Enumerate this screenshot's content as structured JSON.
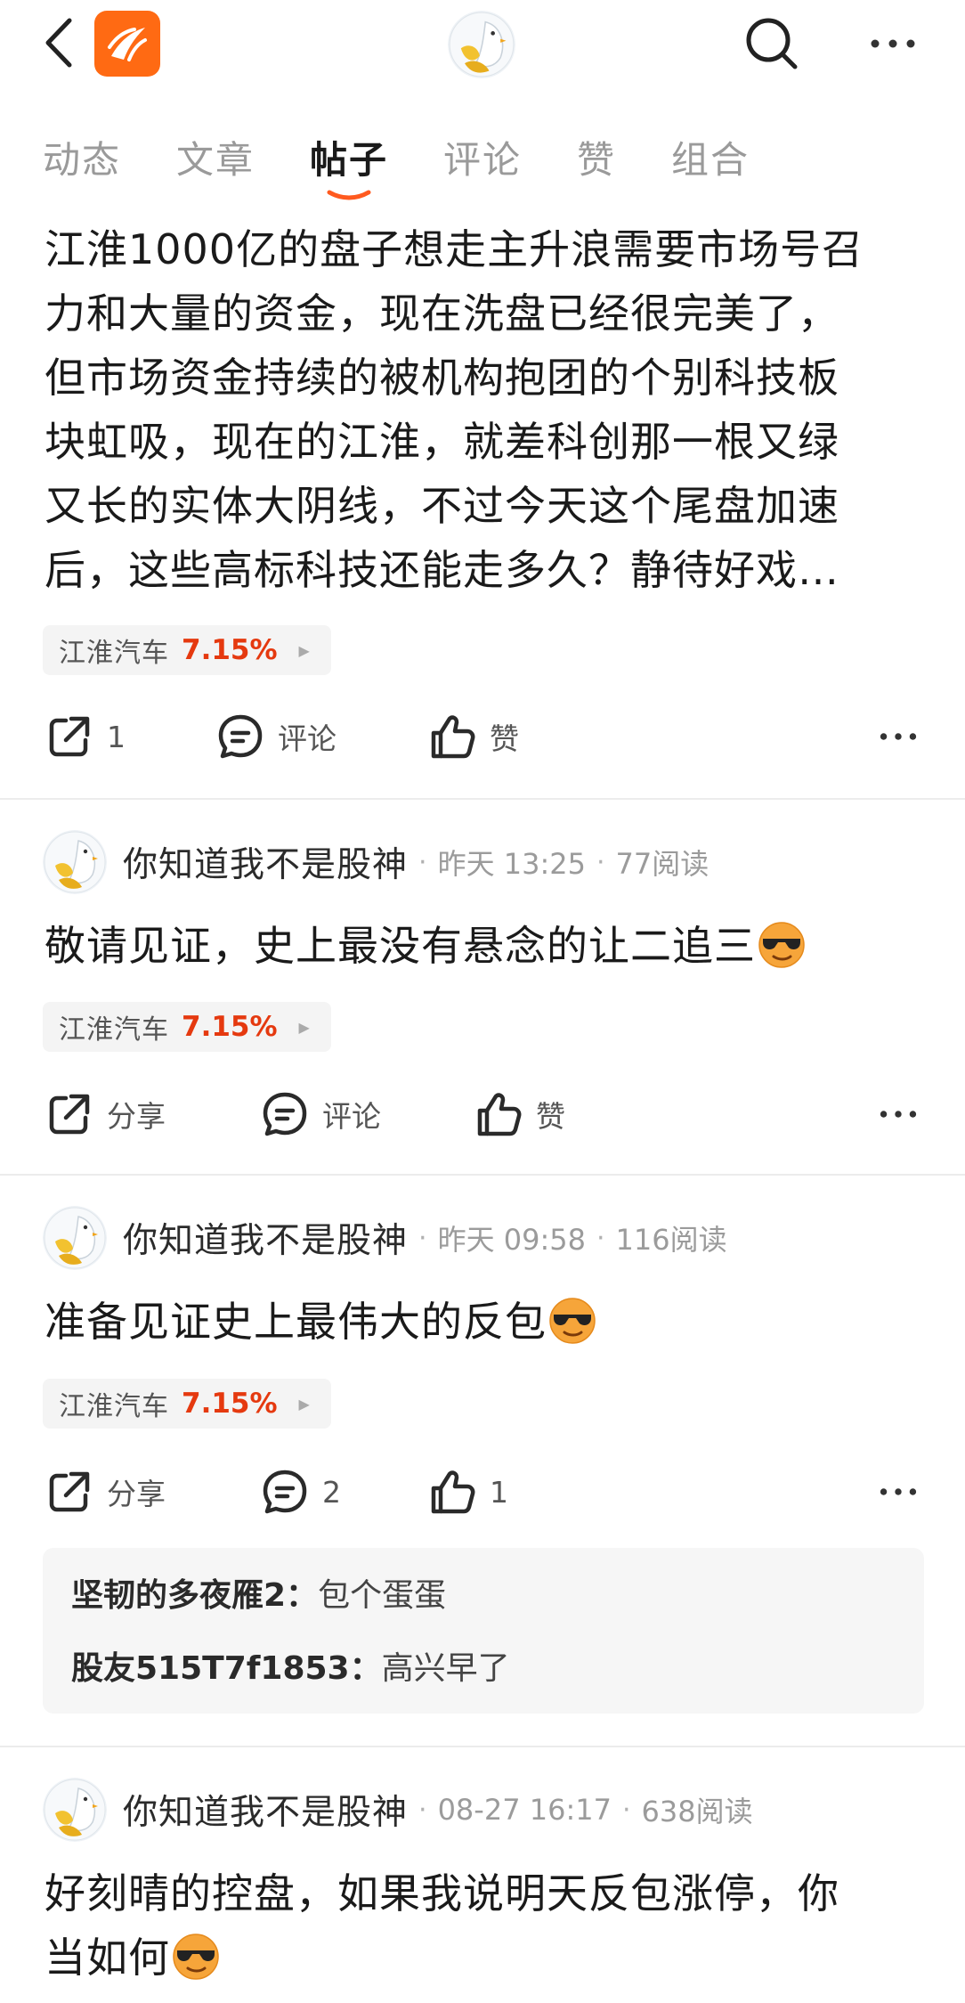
{
  "tabs": [
    "动态",
    "文章",
    "帖子",
    "评论",
    "赞",
    "组合"
  ],
  "active_tab_index": 2,
  "colors": {
    "brand": "#ff6a13",
    "accent_red": "#e5390f"
  },
  "posts": [
    {
      "lines": [
        "江淮1000亿的盘子想走主升浪需要市场号召",
        "力和大量的资金，现在洗盘已经很完美了，",
        "但市场资金持续的被机构抱团的个别科技板",
        "块虹吸，现在的江淮，就差科创那一根又绿",
        "又长的实体大阴线，不过今天这个尾盘加速",
        "后，这些高标科技还能走多久？静待好戏…"
      ],
      "stock": {
        "name": "江淮汽车",
        "change": "7.15%"
      },
      "actions": {
        "share": "1",
        "comment": "评论",
        "like": "赞"
      }
    },
    {
      "author": "你知道我不是股神",
      "time": "昨天 13:25",
      "reads": "77阅读",
      "text": "敬请见证，史上最没有悬念的让二追三",
      "stock": {
        "name": "江淮汽车",
        "change": "7.15%"
      },
      "actions": {
        "share": "分享",
        "comment": "评论",
        "like": "赞"
      }
    },
    {
      "author": "你知道我不是股神",
      "time": "昨天 09:58",
      "reads": "116阅读",
      "text": "准备见证史上最伟大的反包",
      "stock": {
        "name": "江淮汽车",
        "change": "7.15%"
      },
      "actions": {
        "share": "分享",
        "comment": "2",
        "like": "1"
      },
      "comments": [
        {
          "author": "坚韧的多夜雁2：",
          "text": "包个蛋蛋"
        },
        {
          "author": "股友515T7f1853：",
          "text": "高兴早了"
        }
      ]
    },
    {
      "author": "你知道我不是股神",
      "time": "08-27 16:17",
      "reads": "638阅读",
      "lines": [
        "好刻晴的控盘，如果我说明天反包涨停，你",
        "当如何"
      ]
    }
  ]
}
